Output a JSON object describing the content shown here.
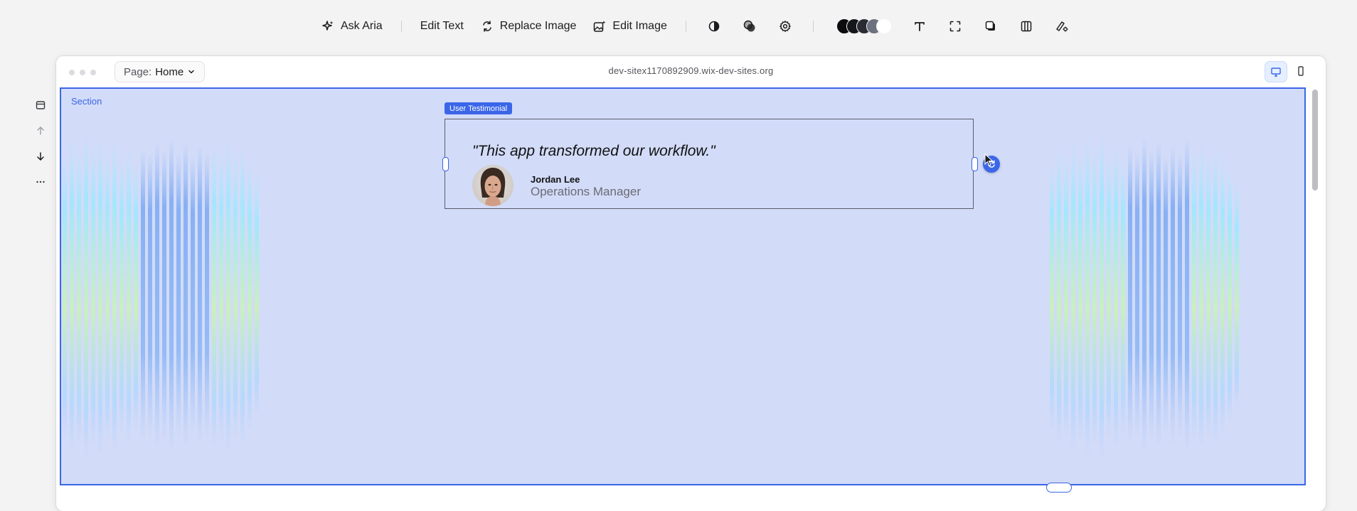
{
  "toolbar": {
    "ask_aria": "Ask Aria",
    "edit_text": "Edit Text",
    "replace_image": "Replace Image",
    "edit_image": "Edit Image",
    "swatch_colors": [
      "#0b0b0e",
      "#15161a",
      "#2a2c33",
      "#6e7280",
      "#ffffff"
    ]
  },
  "browser": {
    "page_prefix": "Page:",
    "page_value": "Home",
    "url": "dev-sitex1170892909.wix-dev-sites.org"
  },
  "canvas": {
    "section_label": "Section",
    "component_tag": "User Testimonial",
    "accent_color": "#3b66e8",
    "section_fill": "#d2dbf8"
  },
  "testimonial": {
    "quote": "\"This app transformed our workflow.\"",
    "author_name": "Jordan Lee",
    "author_role": "Operations Manager"
  }
}
